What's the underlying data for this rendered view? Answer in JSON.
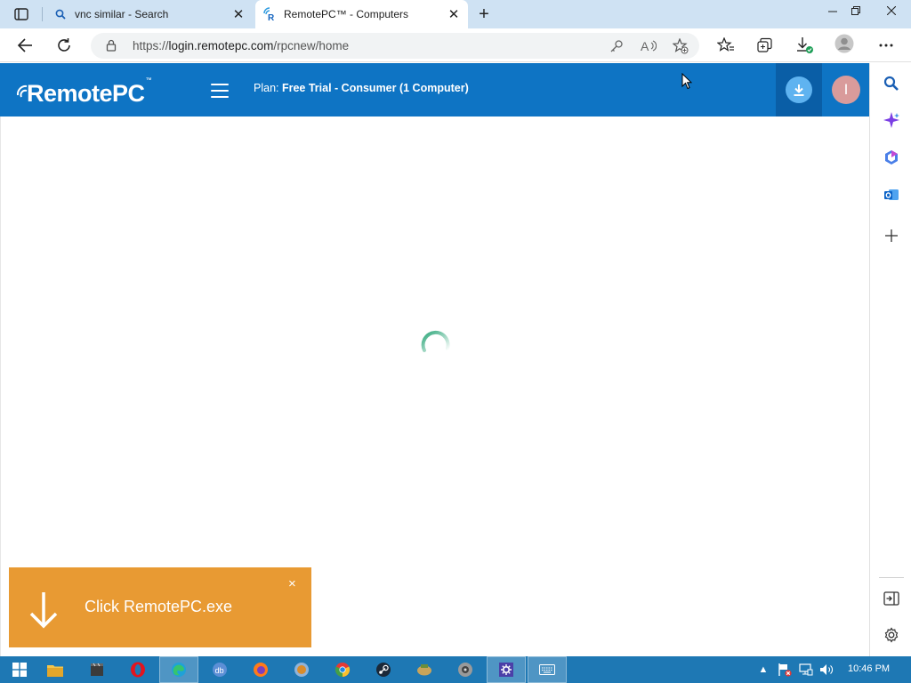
{
  "browser": {
    "tabs": [
      {
        "title": "vnc similar - Search",
        "favicon": "search-icon",
        "active": false
      },
      {
        "title": "RemotePC™ - Computers",
        "favicon": "remotepc-favicon",
        "active": true
      }
    ],
    "address": {
      "scheme": "https://",
      "host": "login.remotepc.com",
      "path": "/rpcnew/home"
    }
  },
  "app": {
    "logo": "RemotePC",
    "logo_tm": "™",
    "plan_label": "Plan:",
    "plan_value": "Free Trial - Consumer (1 Computer)",
    "avatar_initial": "I",
    "accent_color": "#0e74c4"
  },
  "toast": {
    "message": "Click RemotePC.exe",
    "close": "×",
    "color": "#e89a33"
  },
  "taskbar": {
    "time": "10:46 PM",
    "apps": [
      "file-explorer-icon",
      "media-icon",
      "opera-icon",
      "edge-icon",
      "app-icon",
      "firefox-icon",
      "browser-icon",
      "chrome-icon",
      "steam-icon",
      "game-icon",
      "disc-icon",
      "settings-icon",
      "keyboard-icon"
    ]
  }
}
